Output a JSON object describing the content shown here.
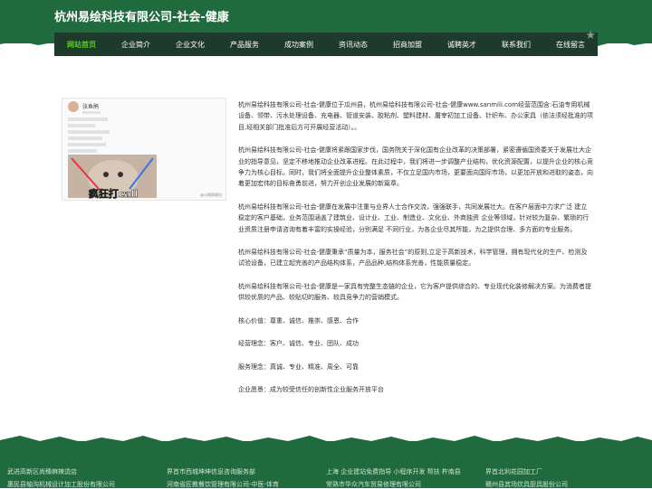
{
  "header": {
    "title": "杭州易绘科技有限公司-社会-健康",
    "nav": [
      "网站首页",
      "企业简介",
      "企业文化",
      "产品服务",
      "成功案例",
      "资讯动态",
      "招商加盟",
      "诚聘英才",
      "联系我们",
      "在线留言"
    ]
  },
  "image": {
    "name_text": "张鱼鹃",
    "caption_line1": "疯狂打call",
    "watermark": "@火锅表情包"
  },
  "content": {
    "paragraphs": [
      "杭州易绘科技有限公司-社会-健康位于瓜州县，杭州易绘科技有限公司-社会-健康www.sanmili.com经营范围含:石油专用机械设备、领带、污水处理设备、充电器、管道安装、胶粘剂、塑料建材、屠宰初加工设备、针织布、办公家具（依法须经批准的项目,经相关部门批准后方可开展经营活动）。。",
      "杭州易绘科技有限公司-社会-健康将紧跟国家步伐，国务院关于深化国有企业改革的决策部署，紧密遵循国资委关于发展壮大企业的指导意见，坚定不移地推动企业改革进程。在此过程中，我们将进一步调整产业结构，优化资源配置，以提升企业的核心竞争力为核心目标。同时，我们将全面提升企业整体素质，不仅立足国内市场，更要面向国际市场，以更加开放和进取的姿态，向着更加宏伟的目标奋勇前进，努力开创企业发展的新篇章。",
      "杭州易绘科技有限公司-社会-健康在发展中注重与业界人士合作交流，强强联手，共同发展壮大。在客户层面中力求广泛 建立稳定的客户基础，业务范围涵盖了建筑业、设计业、工业、制造业、文化业、外商独资 企业等领域，针对较为复杂、繁琐的行业资质注册申请咨询有着丰富的实操经验，分别满足 不同行业，为各企业尽其所能，为之提供合理、多方面的专业服务。",
      "杭州易绘科技有限公司-社会-健康秉承“质量为本，服务社会”的原则,立足于高新技术，科学管理，拥有现代化的生产、检测及试验设备，已建立起完善的产品结构体系，产品品种,结构体系完善，性能质量稳定。",
      "杭州易绘科技有限公司-社会-健康是一家具有完整生态链的企业，它为客户提供综合的、专业现代化装修解决方案。为消费者提供较优质的产品、较贴切的服务、较具竞争力的营销模式。",
      "核心价值：尊重、诚信、推崇、感恩、合作",
      "经营理念：客户、诚信、专业、团队、成功",
      "服务理念：真诚、专业、精准、周全、可靠",
      "企业愿景：成为较受信任的创新性企业服务开放平台"
    ]
  },
  "footer": {
    "links": [
      "武进高新区尚臻麻辣烫店",
      "界首市西城坤坤信息咨询服务部",
      "上海 企业建站免费指导 小程序开发 帮扶 杵南县",
      "界首北利花园加工厂",
      "惠民县轴沟机械设计加工股份有限公司",
      "河南省匠教餐饮管理有限公司-中医-体育",
      "常熟市华众汽车贸易修理有限公司",
      "赣州县其场炊具厨具股份公司"
    ]
  },
  "colors": {
    "green": "#1f6b3d",
    "nav_bg": "#1e3a2a",
    "active": "#4fd11a"
  }
}
